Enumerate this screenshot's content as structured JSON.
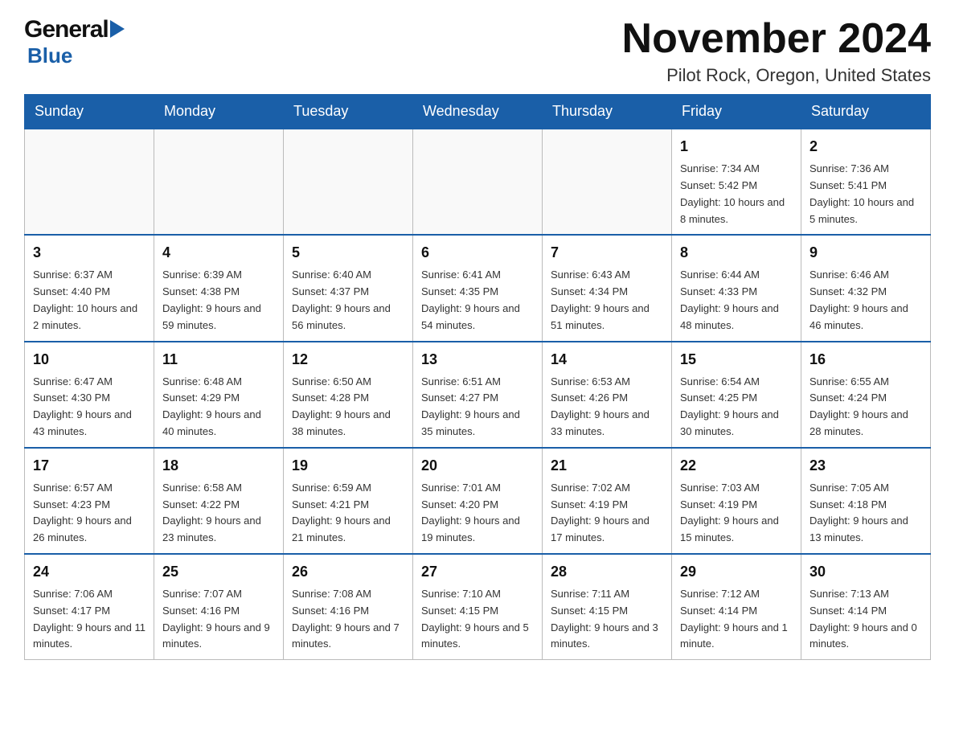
{
  "logo": {
    "general": "General",
    "triangle_char": "▶",
    "blue": "Blue"
  },
  "header": {
    "month_title": "November 2024",
    "location": "Pilot Rock, Oregon, United States"
  },
  "days_of_week": [
    "Sunday",
    "Monday",
    "Tuesday",
    "Wednesday",
    "Thursday",
    "Friday",
    "Saturday"
  ],
  "weeks": [
    {
      "days": [
        {
          "number": "",
          "info": ""
        },
        {
          "number": "",
          "info": ""
        },
        {
          "number": "",
          "info": ""
        },
        {
          "number": "",
          "info": ""
        },
        {
          "number": "",
          "info": ""
        },
        {
          "number": "1",
          "info": "Sunrise: 7:34 AM\nSunset: 5:42 PM\nDaylight: 10 hours and 8 minutes."
        },
        {
          "number": "2",
          "info": "Sunrise: 7:36 AM\nSunset: 5:41 PM\nDaylight: 10 hours and 5 minutes."
        }
      ]
    },
    {
      "days": [
        {
          "number": "3",
          "info": "Sunrise: 6:37 AM\nSunset: 4:40 PM\nDaylight: 10 hours and 2 minutes."
        },
        {
          "number": "4",
          "info": "Sunrise: 6:39 AM\nSunset: 4:38 PM\nDaylight: 9 hours and 59 minutes."
        },
        {
          "number": "5",
          "info": "Sunrise: 6:40 AM\nSunset: 4:37 PM\nDaylight: 9 hours and 56 minutes."
        },
        {
          "number": "6",
          "info": "Sunrise: 6:41 AM\nSunset: 4:35 PM\nDaylight: 9 hours and 54 minutes."
        },
        {
          "number": "7",
          "info": "Sunrise: 6:43 AM\nSunset: 4:34 PM\nDaylight: 9 hours and 51 minutes."
        },
        {
          "number": "8",
          "info": "Sunrise: 6:44 AM\nSunset: 4:33 PM\nDaylight: 9 hours and 48 minutes."
        },
        {
          "number": "9",
          "info": "Sunrise: 6:46 AM\nSunset: 4:32 PM\nDaylight: 9 hours and 46 minutes."
        }
      ]
    },
    {
      "days": [
        {
          "number": "10",
          "info": "Sunrise: 6:47 AM\nSunset: 4:30 PM\nDaylight: 9 hours and 43 minutes."
        },
        {
          "number": "11",
          "info": "Sunrise: 6:48 AM\nSunset: 4:29 PM\nDaylight: 9 hours and 40 minutes."
        },
        {
          "number": "12",
          "info": "Sunrise: 6:50 AM\nSunset: 4:28 PM\nDaylight: 9 hours and 38 minutes."
        },
        {
          "number": "13",
          "info": "Sunrise: 6:51 AM\nSunset: 4:27 PM\nDaylight: 9 hours and 35 minutes."
        },
        {
          "number": "14",
          "info": "Sunrise: 6:53 AM\nSunset: 4:26 PM\nDaylight: 9 hours and 33 minutes."
        },
        {
          "number": "15",
          "info": "Sunrise: 6:54 AM\nSunset: 4:25 PM\nDaylight: 9 hours and 30 minutes."
        },
        {
          "number": "16",
          "info": "Sunrise: 6:55 AM\nSunset: 4:24 PM\nDaylight: 9 hours and 28 minutes."
        }
      ]
    },
    {
      "days": [
        {
          "number": "17",
          "info": "Sunrise: 6:57 AM\nSunset: 4:23 PM\nDaylight: 9 hours and 26 minutes."
        },
        {
          "number": "18",
          "info": "Sunrise: 6:58 AM\nSunset: 4:22 PM\nDaylight: 9 hours and 23 minutes."
        },
        {
          "number": "19",
          "info": "Sunrise: 6:59 AM\nSunset: 4:21 PM\nDaylight: 9 hours and 21 minutes."
        },
        {
          "number": "20",
          "info": "Sunrise: 7:01 AM\nSunset: 4:20 PM\nDaylight: 9 hours and 19 minutes."
        },
        {
          "number": "21",
          "info": "Sunrise: 7:02 AM\nSunset: 4:19 PM\nDaylight: 9 hours and 17 minutes."
        },
        {
          "number": "22",
          "info": "Sunrise: 7:03 AM\nSunset: 4:19 PM\nDaylight: 9 hours and 15 minutes."
        },
        {
          "number": "23",
          "info": "Sunrise: 7:05 AM\nSunset: 4:18 PM\nDaylight: 9 hours and 13 minutes."
        }
      ]
    },
    {
      "days": [
        {
          "number": "24",
          "info": "Sunrise: 7:06 AM\nSunset: 4:17 PM\nDaylight: 9 hours and 11 minutes."
        },
        {
          "number": "25",
          "info": "Sunrise: 7:07 AM\nSunset: 4:16 PM\nDaylight: 9 hours and 9 minutes."
        },
        {
          "number": "26",
          "info": "Sunrise: 7:08 AM\nSunset: 4:16 PM\nDaylight: 9 hours and 7 minutes."
        },
        {
          "number": "27",
          "info": "Sunrise: 7:10 AM\nSunset: 4:15 PM\nDaylight: 9 hours and 5 minutes."
        },
        {
          "number": "28",
          "info": "Sunrise: 7:11 AM\nSunset: 4:15 PM\nDaylight: 9 hours and 3 minutes."
        },
        {
          "number": "29",
          "info": "Sunrise: 7:12 AM\nSunset: 4:14 PM\nDaylight: 9 hours and 1 minute."
        },
        {
          "number": "30",
          "info": "Sunrise: 7:13 AM\nSunset: 4:14 PM\nDaylight: 9 hours and 0 minutes."
        }
      ]
    }
  ]
}
